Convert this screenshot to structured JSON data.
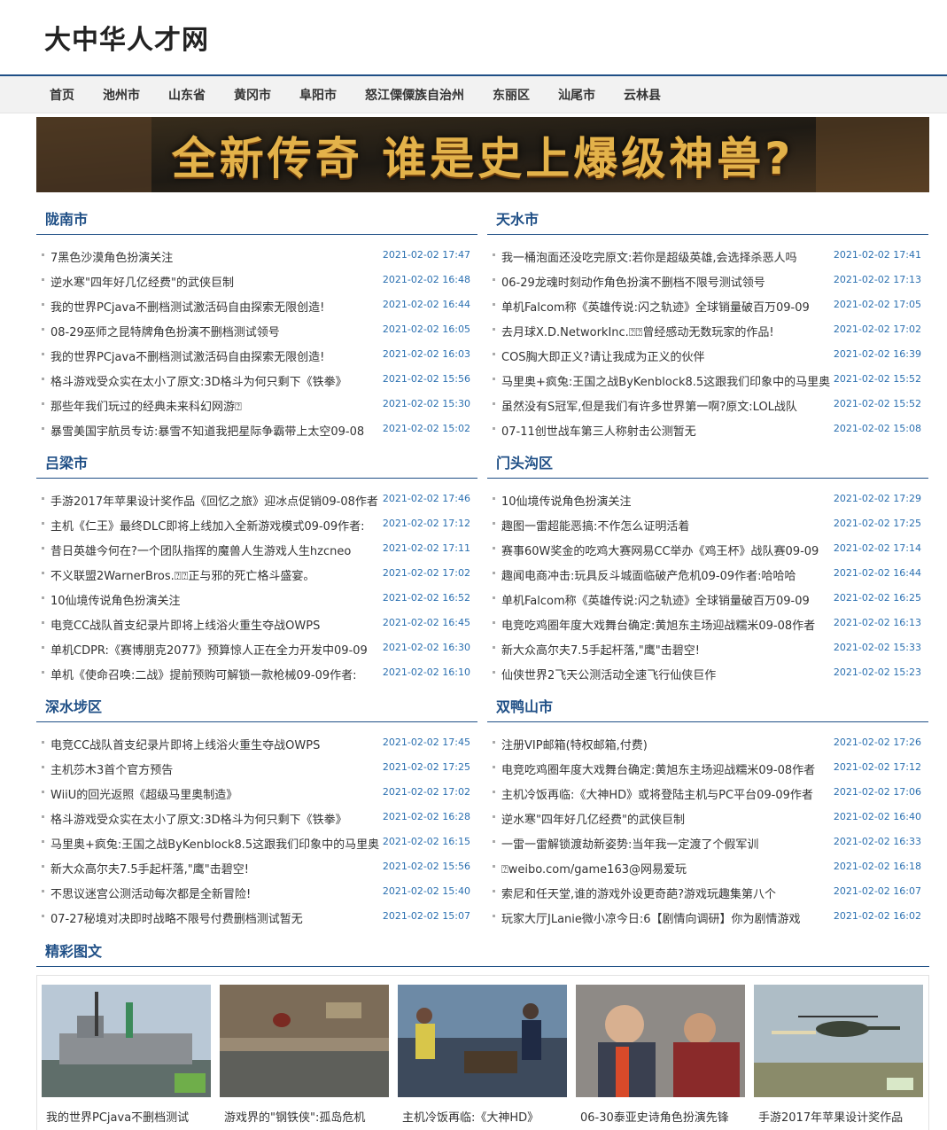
{
  "site": {
    "title": "大中华人才网"
  },
  "nav": [
    {
      "label": "首页"
    },
    {
      "label": "池州市"
    },
    {
      "label": "山东省"
    },
    {
      "label": "黄冈市"
    },
    {
      "label": "阜阳市"
    },
    {
      "label": "怒江傈僳族自治州"
    },
    {
      "label": "东丽区"
    },
    {
      "label": "汕尾市"
    },
    {
      "label": "云林县"
    }
  ],
  "banner": {
    "text": "全新传奇 谁是史上爆级神兽?"
  },
  "sections": [
    {
      "title": "陇南市",
      "items": [
        {
          "title": "7黑色沙漠角色扮演关注",
          "date": "2021-02-02 17:47"
        },
        {
          "title": "逆水寒\"四年好几亿经费\"的武侠巨制",
          "date": "2021-02-02 16:48"
        },
        {
          "title": "我的世界PCjava不删档测试激活码自由探索无限创造!",
          "date": "2021-02-02 16:44"
        },
        {
          "title": "08-29巫师之昆特牌角色扮演不删档测试领号",
          "date": "2021-02-02 16:05"
        },
        {
          "title": "我的世界PCjava不删档测试激活码自由探索无限创造!",
          "date": "2021-02-02 16:03"
        },
        {
          "title": "格斗游戏受众实在太小了原文:3D格斗为何只剩下《铁拳》",
          "date": "2021-02-02 15:56"
        },
        {
          "title": "那些年我们玩过的经典未来科幻网游⍰",
          "date": "2021-02-02 15:30"
        },
        {
          "title": "暴雪美国宇航员专访:暴雪不知道我把星际争霸带上太空09-08",
          "date": "2021-02-02 15:02"
        }
      ]
    },
    {
      "title": "天水市",
      "items": [
        {
          "title": "我一桶泡面还没吃完原文:若你是超级英雄,会选择杀恶人吗",
          "date": "2021-02-02 17:41"
        },
        {
          "title": "06-29龙魂时刻动作角色扮演不删档不限号测试领号",
          "date": "2021-02-02 17:13"
        },
        {
          "title": "单机Falcom称《英雄传说:闪之轨迹》全球销量破百万09-09",
          "date": "2021-02-02 17:05"
        },
        {
          "title": "去月球X.D.NetworkInc.⍰⍰曾经感动无数玩家的作品!",
          "date": "2021-02-02 17:02"
        },
        {
          "title": "COS胸大即正义?请让我成为正义的伙伴",
          "date": "2021-02-02 16:39"
        },
        {
          "title": "马里奥+疯兔:王国之战ByKenblock8.5这跟我们印象中的马里奥",
          "date": "2021-02-02 15:52"
        },
        {
          "title": "虽然没有S冠军,但是我们有许多世界第一啊?原文:LOL战队",
          "date": "2021-02-02 15:52"
        },
        {
          "title": "07-11创世战车第三人称射击公测暂无",
          "date": "2021-02-02 15:08"
        }
      ]
    },
    {
      "title": "吕梁市",
      "items": [
        {
          "title": "手游2017年苹果设计奖作品《回忆之旅》迎冰点促销09-08作者",
          "date": "2021-02-02 17:46"
        },
        {
          "title": "主机《仁王》最终DLC即将上线加入全新游戏模式09-09作者:",
          "date": "2021-02-02 17:12"
        },
        {
          "title": "昔日英雄今何在?一个团队指挥的魔兽人生游戏人生hzcneo",
          "date": "2021-02-02 17:11"
        },
        {
          "title": "不义联盟2WarnerBros.⍰⍰正与邪的死亡格斗盛宴。",
          "date": "2021-02-02 17:02"
        },
        {
          "title": "10仙境传说角色扮演关注",
          "date": "2021-02-02 16:52"
        },
        {
          "title": "电竞CC战队首支纪录片即将上线浴火重生夺战OWPS",
          "date": "2021-02-02 16:45"
        },
        {
          "title": "单机CDPR:《赛博朋克2077》预算惊人正在全力开发中09-09",
          "date": "2021-02-02 16:30"
        },
        {
          "title": "单机《使命召唤:二战》提前预购可解锁一款枪械09-09作者:",
          "date": "2021-02-02 16:10"
        }
      ]
    },
    {
      "title": "门头沟区",
      "items": [
        {
          "title": "10仙境传说角色扮演关注",
          "date": "2021-02-02 17:29"
        },
        {
          "title": "趣图一雷超能恶搞:不作怎么证明活着",
          "date": "2021-02-02 17:25"
        },
        {
          "title": "赛事60W奖金的吃鸡大赛网易CC举办《鸡王杯》战队赛09-09",
          "date": "2021-02-02 17:14"
        },
        {
          "title": "趣闻电商冲击:玩具反斗城面临破产危机09-09作者:哈哈哈",
          "date": "2021-02-02 16:44"
        },
        {
          "title": "单机Falcom称《英雄传说:闪之轨迹》全球销量破百万09-09",
          "date": "2021-02-02 16:25"
        },
        {
          "title": "电竞吃鸡圈年度大戏舞台确定:黄旭东主场迎战糯米09-08作者",
          "date": "2021-02-02 16:13"
        },
        {
          "title": "新大众高尔夫7.5手起杆落,\"鹰\"击碧空!",
          "date": "2021-02-02 15:33"
        },
        {
          "title": "仙侠世界2飞天公测活动全速飞行仙侠巨作",
          "date": "2021-02-02 15:23"
        }
      ]
    },
    {
      "title": "深水埗区",
      "items": [
        {
          "title": "电竞CC战队首支纪录片即将上线浴火重生夺战OWPS",
          "date": "2021-02-02 17:45"
        },
        {
          "title": "主机莎木3首个官方预告",
          "date": "2021-02-02 17:25"
        },
        {
          "title": "WiiU的回光返照《超级马里奥制造》",
          "date": "2021-02-02 17:02"
        },
        {
          "title": "格斗游戏受众实在太小了原文:3D格斗为何只剩下《铁拳》",
          "date": "2021-02-02 16:28"
        },
        {
          "title": "马里奥+疯兔:王国之战ByKenblock8.5这跟我们印象中的马里奥",
          "date": "2021-02-02 16:15"
        },
        {
          "title": "新大众高尔夫7.5手起杆落,\"鹰\"击碧空!",
          "date": "2021-02-02 15:56"
        },
        {
          "title": "不思议迷宫公测活动每次都是全新冒险!",
          "date": "2021-02-02 15:40"
        },
        {
          "title": "07-27秘境对决即时战略不限号付费删档测试暂无",
          "date": "2021-02-02 15:07"
        }
      ]
    },
    {
      "title": "双鸭山市",
      "items": [
        {
          "title": "注册VIP邮箱(特权邮箱,付费)",
          "date": "2021-02-02 17:26"
        },
        {
          "title": "电竞吃鸡圈年度大戏舞台确定:黄旭东主场迎战糯米09-08作者",
          "date": "2021-02-02 17:12"
        },
        {
          "title": "主机冷饭再临:《大神HD》或将登陆主机与PC平台09-09作者",
          "date": "2021-02-02 17:06"
        },
        {
          "title": "逆水寒\"四年好几亿经费\"的武侠巨制",
          "date": "2021-02-02 16:40"
        },
        {
          "title": "一雷一雷解锁渡劫新姿势:当年我一定渡了个假军训",
          "date": "2021-02-02 16:33"
        },
        {
          "title": "⍰weibo.com/game163@网易爱玩",
          "date": "2021-02-02 16:18"
        },
        {
          "title": "索尼和任天堂,谁的游戏外设更奇葩?游戏玩趣集第八个",
          "date": "2021-02-02 16:07"
        },
        {
          "title": "玩家大厅JLanie微小凉今日:6【剧情向调研】你为剧情游戏",
          "date": "2021-02-02 16:02"
        }
      ]
    }
  ],
  "gallery": {
    "title": "精彩图文",
    "items": [
      {
        "caption": "我的世界PCjava不删档测试"
      },
      {
        "caption": "游戏界的\"钢铁侠\":孤岛危机"
      },
      {
        "caption": "主机冷饭再临:《大神HD》"
      },
      {
        "caption": "06-30泰亚史诗角色扮演先锋"
      },
      {
        "caption": "手游2017年苹果设计奖作品"
      }
    ]
  }
}
